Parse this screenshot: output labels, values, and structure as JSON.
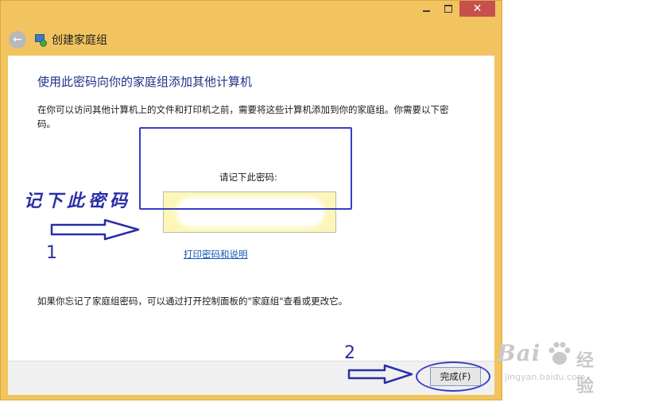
{
  "window": {
    "title": "创建家庭组",
    "controls": {
      "minimize": "—",
      "maximize": "□",
      "close": "✕"
    },
    "back_icon": "←"
  },
  "main": {
    "heading": "使用此密码向你的家庭组添加其他计算机",
    "description": "在你可以访问其他计算机上的文件和打印机之前，需要将这些计算机添加到你的家庭组。你需要以下密码。",
    "password_label": "请记下此密码:",
    "password_value": "",
    "print_link": "打印密码和说明",
    "footer_note": "如果你忘记了家庭组密码，可以通过打开控制面板的\"家庭组\"查看或更改它。"
  },
  "buttons": {
    "finish": "完成(F)"
  },
  "annotations": {
    "note_text": "记下此密码",
    "label_1": "1",
    "label_2": "2",
    "color": "#2a2ea8"
  },
  "watermark": {
    "brand": "Bai",
    "brand_sub": "经验",
    "url": "jingyan.baidu.com"
  },
  "colors": {
    "title_bar": "#f2c45f",
    "close_button": "#c7504d",
    "heading": "#1e3287",
    "link": "#1556b6",
    "password_box": "#fdf6b8"
  },
  "icons": {
    "back": "back-arrow-icon",
    "homegroup": "homegroup-icon",
    "paw": "baidu-paw-icon"
  }
}
